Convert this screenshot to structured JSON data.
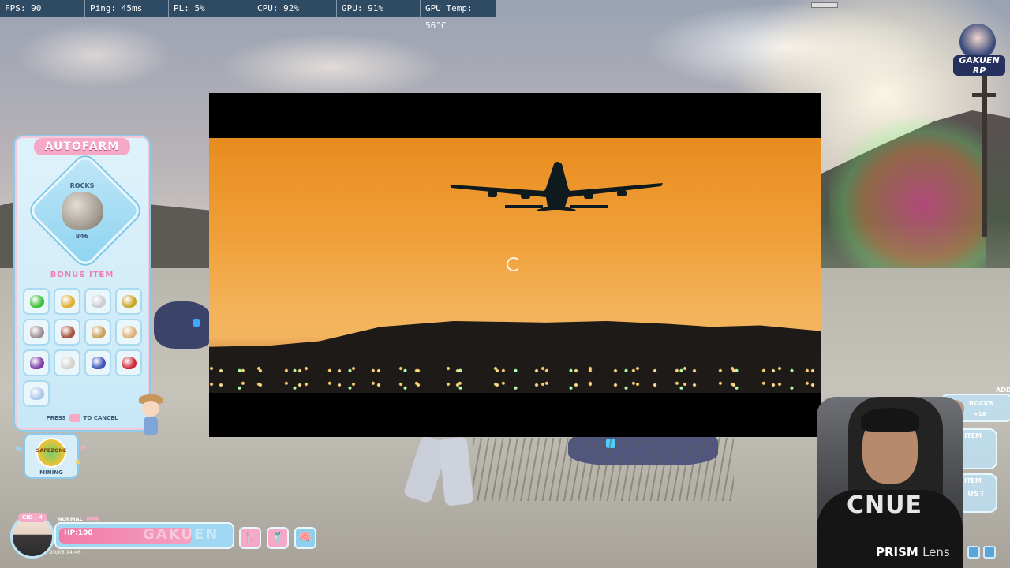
{
  "perf": [
    {
      "label": "FPS: 90"
    },
    {
      "label": "Ping: 45ms"
    },
    {
      "label": "PL: 5%"
    },
    {
      "label": "CPU: 92%"
    },
    {
      "label": "GPU: 91%"
    },
    {
      "label": "GPU Temp: 56°C"
    }
  ],
  "logo": {
    "text": "GAKUEN RP"
  },
  "autofarm": {
    "title": "AUTOFARM",
    "resource_label": "ROCKS",
    "resource_count": "846",
    "bonus_title": "BONUS ITEM",
    "cancel_prefix": "PRESS",
    "cancel_suffix": "TO CANCEL",
    "items": [
      {
        "name": "emerald-icon",
        "color": "#3fbf3f"
      },
      {
        "name": "gold-icon",
        "color": "#e0b030"
      },
      {
        "name": "silver-icon",
        "color": "#c9ccd2"
      },
      {
        "name": "gold-nugget-icon",
        "color": "#c9a52b"
      },
      {
        "name": "iron-ore-icon",
        "color": "#9c8f95"
      },
      {
        "name": "copper-icon",
        "color": "#a8523a"
      },
      {
        "name": "sulfur-icon",
        "color": "#c8a25a"
      },
      {
        "name": "sandstone-icon",
        "color": "#d9b37a"
      },
      {
        "name": "amethyst-icon",
        "color": "#7a3fa8"
      },
      {
        "name": "quartz-icon",
        "color": "#d4d2cf"
      },
      {
        "name": "sapphire-icon",
        "color": "#3d55b8"
      },
      {
        "name": "ruby-icon",
        "color": "#d02a3a"
      },
      {
        "name": "diamond-icon",
        "color": "#a9c8ec"
      }
    ]
  },
  "safezone": {
    "badge": "SAFEZONE",
    "status": "MINING"
  },
  "hud": {
    "cid": "CID : 4",
    "status": "NORMAL",
    "hp": "HP:100",
    "hp_fraction": 0.78,
    "watermark": "GAKUEN",
    "date": "20/08 14:46"
  },
  "hud_buttons": [
    {
      "name": "food-drink-button",
      "icon": "🍴"
    },
    {
      "name": "drink-button",
      "icon": "🥤"
    },
    {
      "name": "brain-button",
      "icon": "🧠"
    }
  ],
  "notifications": {
    "top_label": "ADD",
    "rocks": "ROCKS",
    "rocks_count": "+18",
    "add_item_1": "ADD ITEM",
    "add_item_2": "ITEM",
    "add_item_2_sub": "UST"
  },
  "webcam": {
    "shirt_text": "CNUE",
    "brand": "PRISM",
    "brand_suffix": "Lens"
  }
}
